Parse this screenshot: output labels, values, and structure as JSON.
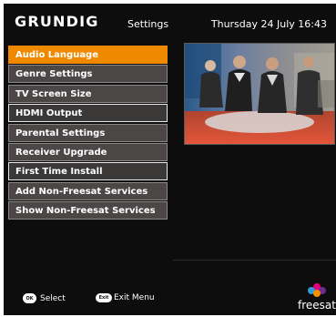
{
  "header": {
    "brand": "GRUNDIG",
    "title": "Settings",
    "datetime": "Thursday 24 July  16:43"
  },
  "menu": {
    "items": [
      {
        "label": "Audio Language",
        "state": "selected"
      },
      {
        "label": "Genre Settings",
        "state": "normal"
      },
      {
        "label": "TV Screen Size",
        "state": "normal"
      },
      {
        "label": "HDMI Output",
        "state": "outlined"
      },
      {
        "label": "Parental Settings",
        "state": "normal"
      },
      {
        "label": "Receiver Upgrade",
        "state": "normal"
      },
      {
        "label": "First Time Install",
        "state": "outlined"
      },
      {
        "label": "Add Non-Freesat Services",
        "state": "normal"
      },
      {
        "label": "Show Non-Freesat Services",
        "state": "normal"
      }
    ]
  },
  "footer": {
    "select_button": "OK",
    "select_label": "Select",
    "exit_button": "Exit",
    "exit_label": "Exit Menu",
    "logo": "freesat"
  },
  "colors": {
    "background": "#0d0d0d",
    "selected": "#ef8a00",
    "menu_item": "#4a4746"
  }
}
